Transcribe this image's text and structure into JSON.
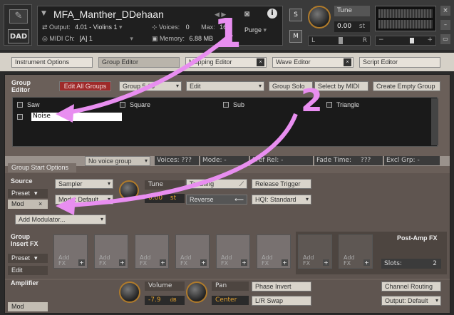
{
  "header": {
    "instrument_name": "MFA_Manther_DDehaan",
    "output_label": "Output:",
    "output_value": "4.01 - Violins 1",
    "voices_label": "Voices:",
    "voices_value": "0",
    "max_label": "Max:",
    "max_value": "16",
    "midi_label": "MIDI Ch:",
    "midi_value": "[A] 1",
    "memory_label": "Memory:",
    "memory_value": "6.88 MB",
    "purge_label": "Purge",
    "solo_label": "S",
    "mute_label": "M",
    "tune_label": "Tune",
    "tune_value": "0.00",
    "tune_unit": "st",
    "pan_left": "L",
    "pan_right": "R",
    "vol_minus": "−",
    "vol_plus": "+",
    "logo_text": "DAD"
  },
  "tabs": [
    {
      "label": "Instrument Options"
    },
    {
      "label": "Group Editor"
    },
    {
      "label": "Mapping Editor"
    },
    {
      "label": "Wave Editor"
    },
    {
      "label": "Script Editor"
    }
  ],
  "group_editor": {
    "title_line1": "Group",
    "title_line2": "Editor",
    "edit_all": "Edit All Groups",
    "group_selector": "Group 5 / 5",
    "edit_menu": "Edit",
    "group_solo": "Group Solo",
    "select_by_midi": "Select by MIDI",
    "create_empty": "Create Empty Group",
    "groups": [
      "Saw",
      "Square",
      "Sub",
      "Triangle"
    ],
    "editing_group": "Noise"
  },
  "group_start": {
    "tab_label": "Group Start Options",
    "voice_group": "No voice group",
    "voices": "Voices: ???",
    "mode": "Mode: -",
    "pref_rel": "Pref Rel: -",
    "fade_time": "Fade Time:",
    "fade_val": "???",
    "excl_grp": "Excl Grp: -"
  },
  "source": {
    "title": "Source",
    "preset": "Preset",
    "mod": "Mod",
    "close": "×",
    "sampler": "Sampler",
    "mode": "Mode: Default",
    "tune_label": "Tune",
    "tune_value": "0.00",
    "tune_unit": "st",
    "tracking": "Tracking",
    "reverse": "Reverse",
    "release_trigger": "Release Trigger",
    "hqi": "HQI: Standard",
    "add_modulator": "Add Modulator..."
  },
  "insert_fx": {
    "title_line1": "Group",
    "title_line2": "Insert FX",
    "preset": "Preset",
    "edit": "Edit",
    "slot_label_line1": "Add",
    "slot_label_line2": "FX",
    "slot_plus": "+",
    "postamp_title": "Post-Amp FX",
    "slots_label": "Slots:",
    "slots_value": "2"
  },
  "amplifier": {
    "title": "Amplifier",
    "mod": "Mod",
    "volume_label": "Volume",
    "volume_value": "-7.9",
    "volume_unit": "dB",
    "pan_label": "Pan",
    "pan_value": "Center",
    "phase_invert": "Phase Invert",
    "lr_swap": "L/R Swap",
    "channel_routing": "Channel Routing",
    "output": "Output: Default"
  },
  "annotations": {
    "one": "1",
    "two": "2"
  },
  "colors": {
    "accent_orange": "#b07b2b",
    "annotation_pink": "#e88ef0",
    "edit_all_red": "#9e2a2a"
  }
}
